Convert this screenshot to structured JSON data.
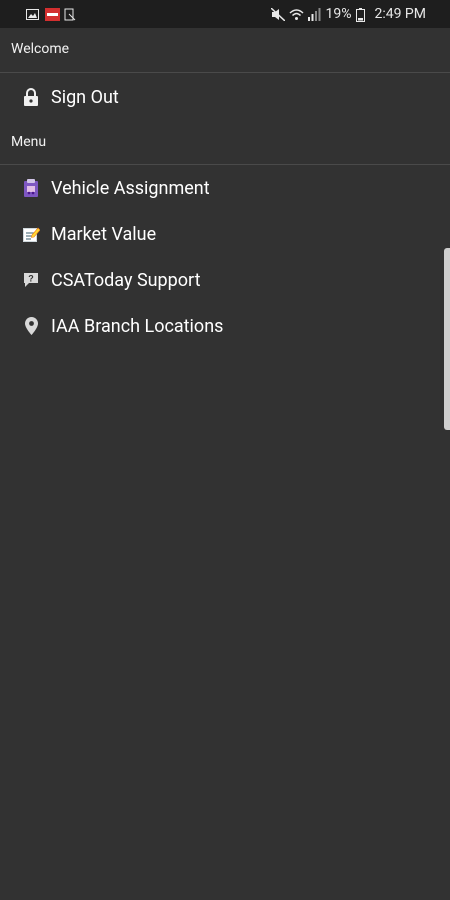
{
  "status_bar": {
    "battery": "19%",
    "time": "2:49 PM",
    "left_icons": [
      "gallery-icon",
      "notification-flag-icon",
      "app-icon"
    ],
    "right_icons": [
      "mute-icon",
      "wifi-icon",
      "signal-icon",
      "battery-icon"
    ]
  },
  "sections": {
    "welcome": "Welcome",
    "menu": "Menu"
  },
  "account_items": [
    {
      "label": "Sign Out",
      "icon": "lock-icon"
    }
  ],
  "menu_items": [
    {
      "label": "Vehicle Assignment",
      "icon": "vehicle-assignment-icon"
    },
    {
      "label": "Market Value",
      "icon": "market-value-icon"
    },
    {
      "label": "CSAToday Support",
      "icon": "support-chat-icon"
    },
    {
      "label": "IAA Branch Locations",
      "icon": "location-pin-icon"
    }
  ],
  "colors": {
    "background": "#323232",
    "status_bar": "#1e1e1e",
    "divider": "#4a4a4a",
    "text": "#ffffff",
    "scrollbar": "#cfcfcf"
  }
}
